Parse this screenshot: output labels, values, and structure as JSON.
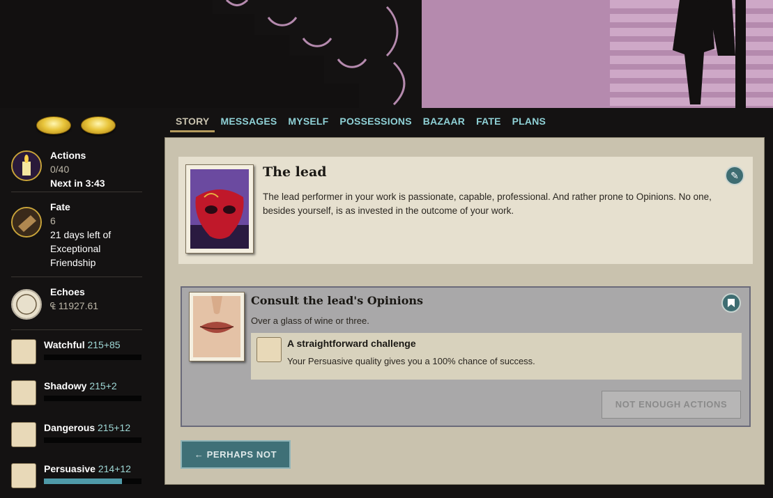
{
  "tabs": [
    "STORY",
    "MESSAGES",
    "MYSELF",
    "POSSESSIONS",
    "BAZAAR",
    "FATE",
    "PLANS"
  ],
  "sidebar": {
    "actions": {
      "label": "Actions",
      "value": "0/40",
      "next": "Next in 3:43",
      "icon": "candle-icon"
    },
    "fate": {
      "label": "Fate",
      "value": "6",
      "note": "21 days left of Exceptional Friendship",
      "icon": "book-icon"
    },
    "echoes": {
      "label": "Echoes",
      "value": "11927.61",
      "currency_symbol": "₠",
      "icon": "echo-coin-icon"
    },
    "qualities": [
      {
        "name": "Watchful",
        "value": "215",
        "bonus": "+85",
        "icon": "fox-icon",
        "progress": 0
      },
      {
        "name": "Shadowy",
        "value": "215",
        "bonus": "+2",
        "icon": "cat-icon",
        "progress": 0
      },
      {
        "name": "Dangerous",
        "value": "215",
        "bonus": "+12",
        "icon": "bear-icon",
        "progress": 0
      },
      {
        "name": "Persuasive",
        "value": "214",
        "bonus": "+12",
        "icon": "fox-icon",
        "progress": 0.8
      }
    ]
  },
  "storylet": {
    "title": "The lead",
    "description": "The lead performer in your work is passionate, capable, professional. And rather prone to Opinions. No one, besides yourself, is as invested in the outcome of your work.",
    "image": "red-mask-icon"
  },
  "branch": {
    "title": "Consult the lead's Opinions",
    "description": "Over a glass of wine or three.",
    "image": "lips-icon",
    "challenge_title": "A straightforward challenge",
    "challenge_desc": "Your Persuasive quality gives you a 100% chance of success.",
    "button": "NOT ENOUGH ACTIONS"
  },
  "perhaps_not": "PERHAPS NOT",
  "colors": {
    "accent": "#3e6d72",
    "tab": "#8fd1d6",
    "quality_bonus": "#9fd8d6"
  }
}
